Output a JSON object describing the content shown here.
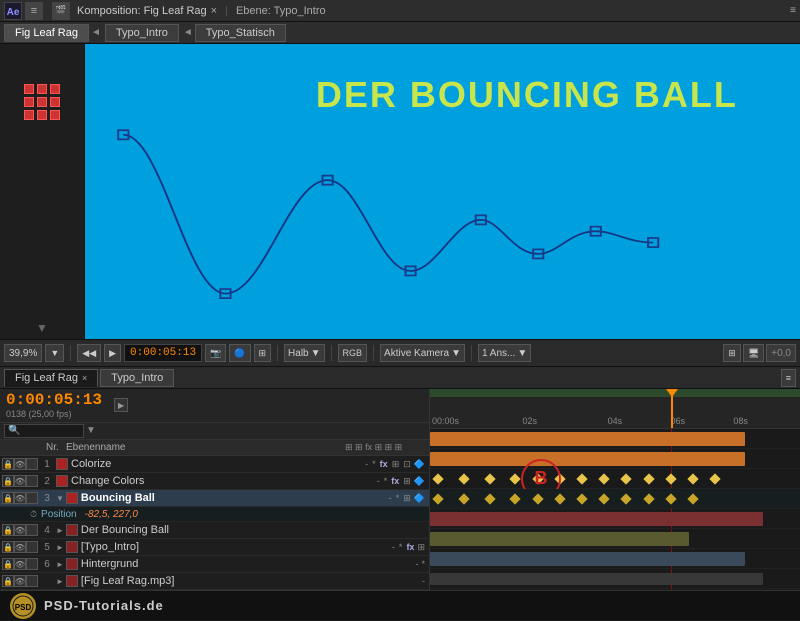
{
  "topbar": {
    "app_icon": "AE",
    "composition_label": "Komposition: Fig Leaf Rag",
    "layer_label": "Ebene: Typo_Intro",
    "close_icon": "×",
    "menu_icon": "≡"
  },
  "tabs": {
    "comp_tabs": [
      {
        "label": "Fig Leaf Rag",
        "active": true
      },
      {
        "label": "Typo_Intro",
        "active": false
      },
      {
        "label": "Typo_Statisch",
        "active": false
      }
    ]
  },
  "canvas": {
    "title": "DER BOUNCING BALL",
    "zoom": "39,9%",
    "time": "0:00:05:13",
    "quality": "Halb",
    "view": "Aktive Kamera",
    "preset": "1 Ans..."
  },
  "timeline": {
    "tab1": "Fig Leaf Rag",
    "tab2": "Typo_Intro",
    "time": "0:00:05:13",
    "fps": "0138 (25,00 fps)",
    "ruler_marks": [
      "00:00s",
      "02s",
      "04s",
      "06s",
      "08s"
    ],
    "search_placeholder": "🔍",
    "columns": {
      "nr": "Nr.",
      "name": "Ebenenname",
      "switches": ""
    },
    "layers": [
      {
        "num": "1",
        "name": "Colorize",
        "color": "#aa2222",
        "has_fx": true,
        "expanded": false
      },
      {
        "num": "2",
        "name": "Change Colors",
        "color": "#aa2222",
        "has_fx": true,
        "expanded": false
      },
      {
        "num": "3",
        "name": "Bouncing Ball",
        "color": "#aa2222",
        "has_fx": false,
        "expanded": true,
        "selected": true
      },
      {
        "num": "",
        "name": "Position",
        "color": "",
        "is_sub": true,
        "value": "-82,5, 227,0"
      },
      {
        "num": "4",
        "name": "Der Bouncing Ball",
        "color": "#882222",
        "expanded": false
      },
      {
        "num": "5",
        "name": "[Typo_Intro]",
        "color": "#882222",
        "has_fx": true,
        "expanded": false
      },
      {
        "num": "6",
        "name": "Hintergrund",
        "color": "#882222",
        "expanded": false
      },
      {
        "num": "",
        "name": "[Fig Leaf Rag.mp3]",
        "color": "#882222",
        "expanded": false
      }
    ]
  },
  "logo": {
    "text": "PSD-Tutorials.de",
    "symbol": "PSD"
  }
}
